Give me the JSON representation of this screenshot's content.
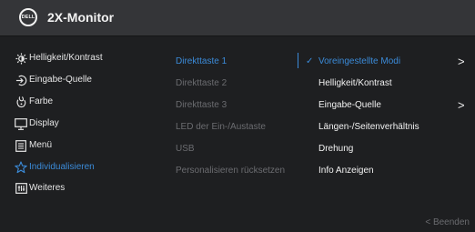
{
  "header": {
    "logo_text": "DELL",
    "title": "2X-Monitor"
  },
  "menu": [
    {
      "label": "Helligkeit/Kontrast",
      "icon": "brightness-icon"
    },
    {
      "label": "Eingabe-Quelle",
      "icon": "input-source-icon"
    },
    {
      "label": "Farbe",
      "icon": "color-icon"
    },
    {
      "label": "Display",
      "icon": "display-icon"
    },
    {
      "label": "Menü",
      "icon": "menu-icon"
    },
    {
      "label": "Individualisieren",
      "icon": "star-icon"
    },
    {
      "label": "Weiteres",
      "icon": "others-icon"
    }
  ],
  "personalize": [
    "Direkttaste 1",
    "Direkttaste 2",
    "Direkttaste 3",
    "LED der Ein-/Austaste",
    "USB",
    "Personalisieren rücksetzen"
  ],
  "options": [
    {
      "label": "Voreingestellte Modi",
      "check": "✓",
      "arrow": ">"
    },
    {
      "label": "Helligkeit/Kontrast"
    },
    {
      "label": "Eingabe-Quelle",
      "arrow": ">"
    },
    {
      "label": "Längen-/Seitenverhältnis"
    },
    {
      "label": "Drehung"
    },
    {
      "label": "Info Anzeigen"
    }
  ],
  "footer": {
    "exit_label": "< Beenden"
  },
  "colors": {
    "accent": "#3b8bd9",
    "header_bg": "#343538",
    "body_bg": "#1e1f21",
    "dim_text": "#6b6c70"
  }
}
